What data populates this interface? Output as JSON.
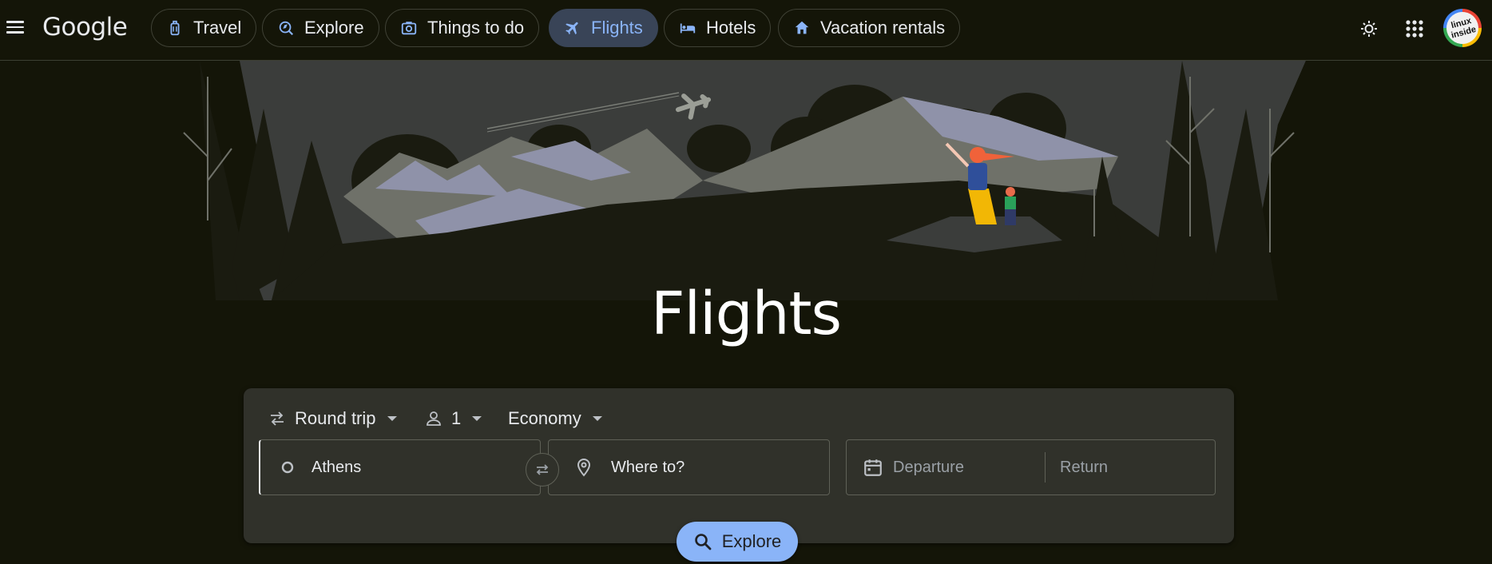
{
  "header": {
    "logo": "Google",
    "nav": [
      {
        "label": "Travel",
        "icon": "luggage-icon"
      },
      {
        "label": "Explore",
        "icon": "explore-icon"
      },
      {
        "label": "Things to do",
        "icon": "camera-icon"
      },
      {
        "label": "Flights",
        "icon": "airplane-icon",
        "active": true
      },
      {
        "label": "Hotels",
        "icon": "bed-icon"
      },
      {
        "label": "Vacation rentals",
        "icon": "home-icon"
      }
    ],
    "avatar_text": "linux inside"
  },
  "hero": {
    "title": "Flights"
  },
  "search": {
    "trip_type": "Round trip",
    "passengers": "1",
    "cabin_class": "Economy",
    "origin": "Athens",
    "destination_placeholder": "Where to?",
    "departure_placeholder": "Departure",
    "return_placeholder": "Return",
    "explore_label": "Explore"
  },
  "colors": {
    "background": "#141508",
    "card": "#30312a",
    "accent": "#8ab4f8",
    "active_chip": "#394457"
  }
}
